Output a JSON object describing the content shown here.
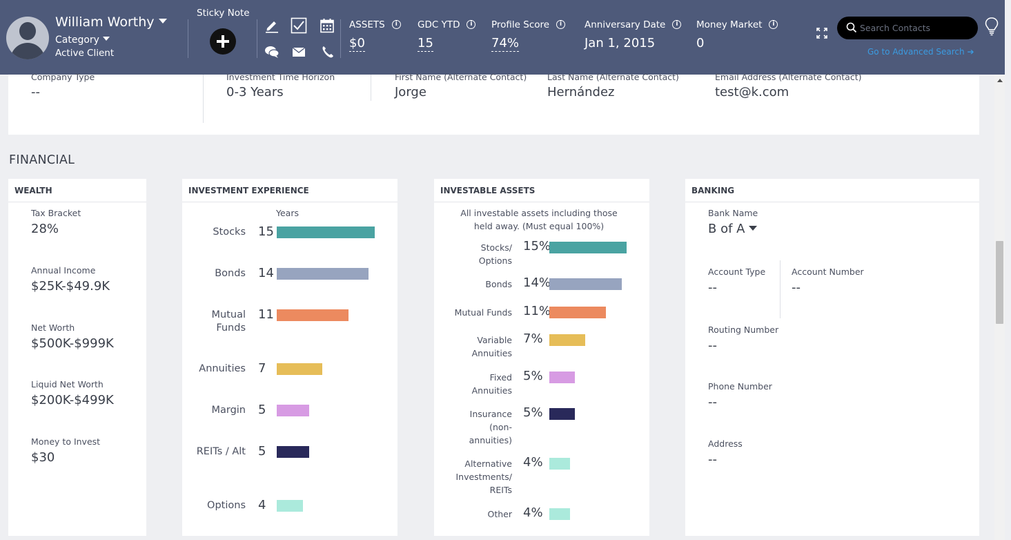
{
  "header": {
    "client_name": "William Worthy",
    "category_label": "Category",
    "status": "Active Client",
    "sticky_note_label": "Sticky Note",
    "metrics": [
      {
        "label": "ASSETS",
        "value": "$0"
      },
      {
        "label": "GDC YTD",
        "value": "15"
      },
      {
        "label": "Profile Score",
        "value": "74%"
      },
      {
        "label": "Anniversary Date",
        "value": "Jan 1, 2015"
      },
      {
        "label": "Money Market",
        "value": "0"
      }
    ],
    "info_glyph": "i",
    "search_placeholder": "Search Contacts",
    "advanced_search": "Go to Advanced Search ➔"
  },
  "top_fields": [
    {
      "label": "Company Type",
      "value": "--"
    },
    {
      "label": "Investment Time Horizon",
      "value": "0-3 Years"
    },
    {
      "label": "First Name (Alternate Contact)",
      "value": "Jorge"
    },
    {
      "label": "Last Name (Alternate Contact)",
      "value": "Hernández"
    },
    {
      "label": "Email Address (Alternate Contact)",
      "value": "test@k.com"
    }
  ],
  "financial": {
    "section_title": "FINANCIAL",
    "wealth": {
      "title": "WEALTH",
      "fields": [
        {
          "label": "Tax Bracket",
          "value": "28%"
        },
        {
          "label": "Annual Income",
          "value": "$25K-$49.9K"
        },
        {
          "label": "Net Worth",
          "value": "$500K-$999K"
        },
        {
          "label": "Liquid Net Worth",
          "value": "$200K-$499K"
        },
        {
          "label": "Money to Invest",
          "value": "$30"
        }
      ]
    },
    "investment_experience": {
      "title": "INVESTMENT EXPERIENCE",
      "years_label": "Years",
      "items": [
        {
          "label": "Stocks",
          "value": 15,
          "color": "#4aa3a2"
        },
        {
          "label": "Bonds",
          "value": 14,
          "color": "#97a4bf"
        },
        {
          "label": "Mutual Funds",
          "value": 11,
          "color": "#ec8a5f"
        },
        {
          "label": "Annuities",
          "value": 7,
          "color": "#e6bd58"
        },
        {
          "label": "Margin",
          "value": 5,
          "color": "#d79be3"
        },
        {
          "label": "REITs / Alt",
          "value": 5,
          "color": "#29295a"
        },
        {
          "label": "Options",
          "value": 4,
          "color": "#abeadc"
        }
      ]
    },
    "investable_assets": {
      "title": "INVESTABLE ASSETS",
      "note": "All investable assets including those held away. (Must equal 100%)",
      "items": [
        {
          "label": "Stocks/ Options",
          "value": "15%",
          "pct": 15,
          "color": "#4aa3a2"
        },
        {
          "label": "Bonds",
          "value": "14%",
          "pct": 14,
          "color": "#97a4bf"
        },
        {
          "label": "Mutual Funds",
          "value": "11%",
          "pct": 11,
          "color": "#ec8a5f"
        },
        {
          "label": "Variable Annuities",
          "value": "7%",
          "pct": 7,
          "color": "#e6bd58"
        },
        {
          "label": "Fixed Annuities",
          "value": "5%",
          "pct": 5,
          "color": "#d79be3"
        },
        {
          "label": "Insurance (non-annuities)",
          "value": "5%",
          "pct": 5,
          "color": "#29295a"
        },
        {
          "label": "Alternative Investments/ REITs",
          "value": "4%",
          "pct": 4,
          "color": "#abeadc"
        },
        {
          "label": "Other",
          "value": "4%",
          "pct": 4,
          "color": "#abeadc"
        }
      ]
    },
    "banking": {
      "title": "BANKING",
      "bank_name_label": "Bank Name",
      "bank_name_value": "B of A",
      "account_type_label": "Account Type",
      "account_type_value": "--",
      "account_number_label": "Account Number",
      "account_number_value": "--",
      "routing_label": "Routing Number",
      "routing_value": "--",
      "phone_label": "Phone Number",
      "phone_value": "--",
      "address_label": "Address",
      "address_value": "--"
    }
  }
}
